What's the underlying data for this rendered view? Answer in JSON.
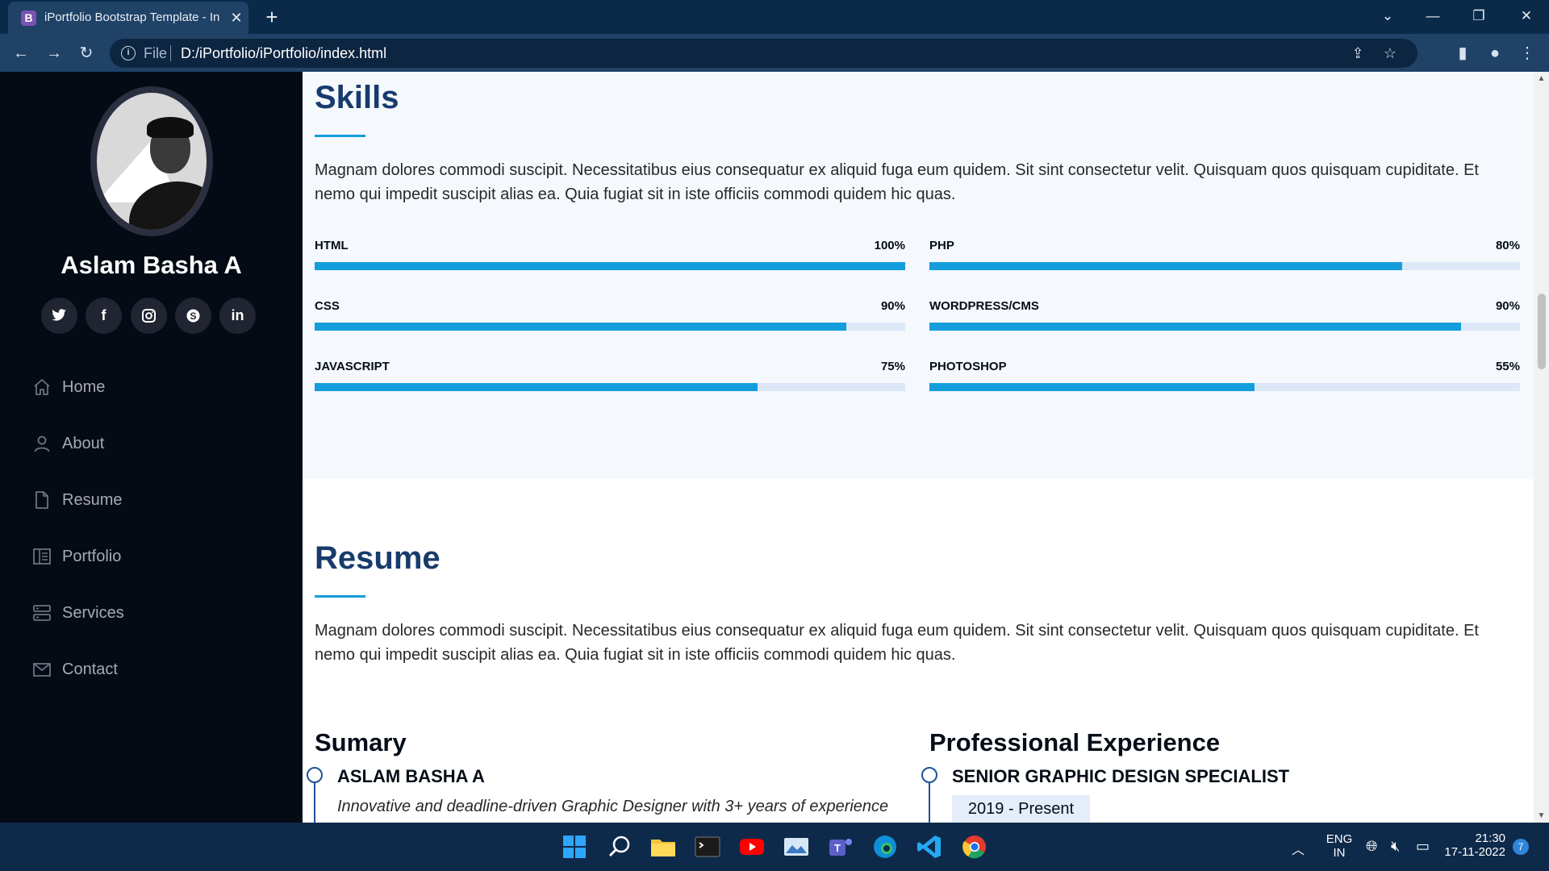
{
  "browser": {
    "tab_title": "iPortfolio Bootstrap Template - In",
    "tab_favicon": "B",
    "file_label": "File",
    "url": "D:/iPortfolio/iPortfolio/index.html"
  },
  "sidebar": {
    "name": "Aslam Basha A",
    "socials": [
      {
        "label": "twitter-icon",
        "glyph": "🐦"
      },
      {
        "label": "facebook-icon",
        "glyph": "f"
      },
      {
        "label": "instagram-icon",
        "glyph": "◎"
      },
      {
        "label": "skype-icon",
        "glyph": "S"
      },
      {
        "label": "linkedin-icon",
        "glyph": "in"
      }
    ],
    "nav": [
      {
        "label": "Home",
        "icon": "home-icon"
      },
      {
        "label": "About",
        "icon": "person-icon"
      },
      {
        "label": "Resume",
        "icon": "file-icon"
      },
      {
        "label": "Portfolio",
        "icon": "book-icon"
      },
      {
        "label": "Services",
        "icon": "server-icon"
      },
      {
        "label": "Contact",
        "icon": "envelope-icon"
      }
    ]
  },
  "skills": {
    "title": "Skills",
    "description": "Magnam dolores commodi suscipit. Necessitatibus eius consequatur ex aliquid fuga eum quidem. Sit sint consectetur velit. Quisquam quos quisquam cupiditate. Et nemo qui impedit suscipit alias ea. Quia fugiat sit in iste officiis commodi quidem hic quas.",
    "items": [
      {
        "name": "HTML",
        "value": "100%",
        "percent": 100
      },
      {
        "name": "PHP",
        "value": "80%",
        "percent": 80
      },
      {
        "name": "CSS",
        "value": "90%",
        "percent": 90
      },
      {
        "name": "WORDPRESS/CMS",
        "value": "90%",
        "percent": 90
      },
      {
        "name": "JAVASCRIPT",
        "value": "75%",
        "percent": 75
      },
      {
        "name": "PHOTOSHOP",
        "value": "55%",
        "percent": 55
      }
    ]
  },
  "resume": {
    "title": "Resume",
    "description": "Magnam dolores commodi suscipit. Necessitatibus eius consequatur ex aliquid fuga eum quidem. Sit sint consectetur velit. Quisquam quos quisquam cupiditate. Et nemo qui impedit suscipit alias ea. Quia fugiat sit in iste officiis commodi quidem hic quas.",
    "summary_title": "Sumary",
    "summary_name": "ASLAM BASHA A",
    "summary_text": "Innovative and deadline-driven Graphic Designer with 3+ years of experience",
    "experience_title": "Professional Experience",
    "experience_role": "SENIOR GRAPHIC DESIGN SPECIALIST",
    "experience_date": "2019 - Present"
  },
  "taskbar": {
    "lang_top": "ENG",
    "lang_bottom": "IN",
    "time": "21:30",
    "date": "17-11-2022",
    "notification_count": "7"
  },
  "colors": {
    "accent": "#149ddd",
    "heading": "#173b6c",
    "sidebar_bg": "#040b14"
  }
}
